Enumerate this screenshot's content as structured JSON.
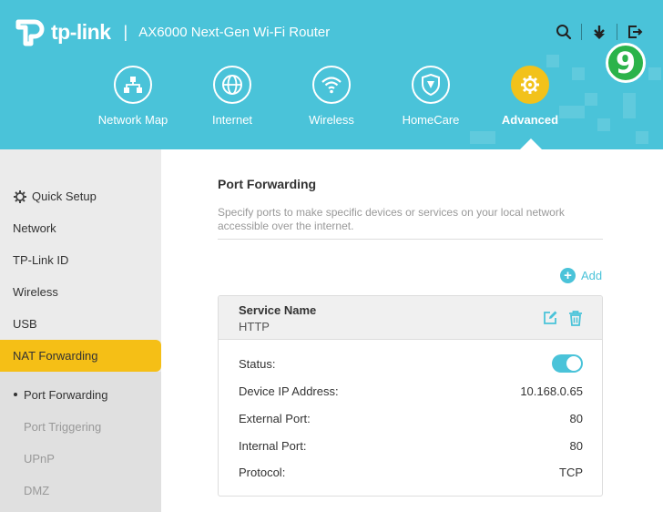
{
  "header": {
    "brand": "tp-link",
    "product": "AX6000 Next-Gen Wi-Fi Router",
    "separator": "|",
    "step_badge": "9",
    "accent": "#4ac3d9",
    "active_color": "#f2c21b",
    "icons": [
      "search-icon",
      "download-icon",
      "logout-icon"
    ]
  },
  "nav": [
    {
      "label": "Network Map",
      "icon": "network-map-icon"
    },
    {
      "label": "Internet",
      "icon": "globe-icon"
    },
    {
      "label": "Wireless",
      "icon": "wifi-icon"
    },
    {
      "label": "HomeCare",
      "icon": "shield-icon"
    },
    {
      "label": "Advanced",
      "icon": "gear-icon",
      "active": true
    }
  ],
  "sidebar": {
    "items": [
      {
        "label": "Quick Setup",
        "icon": "gear-icon"
      },
      {
        "label": "Network"
      },
      {
        "label": "TP-Link ID"
      },
      {
        "label": "Wireless"
      },
      {
        "label": "USB"
      },
      {
        "label": "NAT Forwarding",
        "active": true
      }
    ],
    "sub_items": [
      {
        "label": "Port Forwarding",
        "current": true
      },
      {
        "label": "Port Triggering"
      },
      {
        "label": "UPnP"
      },
      {
        "label": "DMZ"
      }
    ]
  },
  "main": {
    "title": "Port Forwarding",
    "description": "Specify ports to make specific devices or services on your local network accessible over the internet.",
    "add_label": "Add",
    "card": {
      "service_label": "Service Name",
      "service_value": "HTTP",
      "rows": [
        {
          "label": "Status:",
          "value": "",
          "toggle": true,
          "enabled": true
        },
        {
          "label": "Device IP Address:",
          "value": "10.168.0.65"
        },
        {
          "label": "External Port:",
          "value": "80"
        },
        {
          "label": "Internal Port:",
          "value": "80"
        },
        {
          "label": "Protocol:",
          "value": "TCP"
        }
      ]
    }
  }
}
